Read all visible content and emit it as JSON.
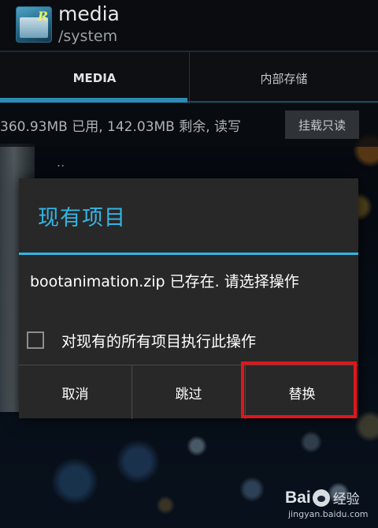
{
  "app": {
    "title": "media",
    "subtitle": "/system"
  },
  "tabs": [
    {
      "label": "MEDIA",
      "selected": true
    },
    {
      "label": "内部存储",
      "selected": false
    }
  ],
  "storage": {
    "info": "360.93MB 已用, 142.03MB 剩余, 读写",
    "mount_button": "挂载只读"
  },
  "background": {
    "partial_item_text": ".."
  },
  "dialog": {
    "title": "现有项目",
    "message": "bootanimation.zip 已存在. 请选择操作",
    "checkbox_label": "对现有的所有项目执行此操作",
    "checkbox_checked": false,
    "buttons": {
      "cancel": "取消",
      "skip": "跳过",
      "replace": "替换"
    }
  },
  "colors": {
    "accent": "#33b5e5",
    "highlight": "#e0161b",
    "dialog_bg": "#282828"
  },
  "watermark": {
    "brand_left": "Bai",
    "brand_cn": "经验",
    "url": "jingyan.baidu.com"
  }
}
